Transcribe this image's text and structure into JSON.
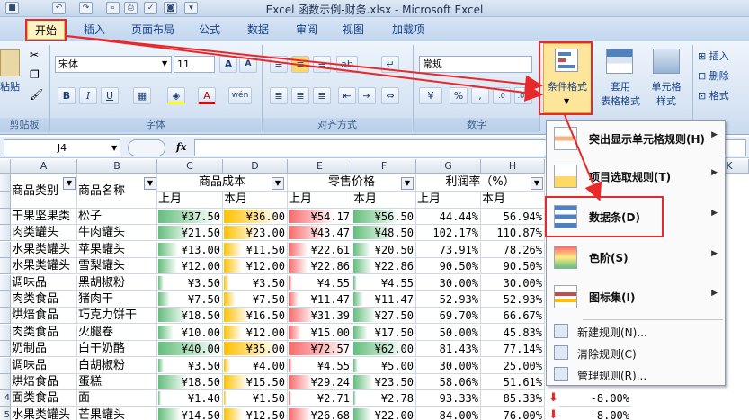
{
  "title": "Excel 函数示例-财务.xlsx - Microsoft Excel",
  "tabs": [
    "开始",
    "插入",
    "页面布局",
    "公式",
    "数据",
    "审阅",
    "视图",
    "加载项"
  ],
  "ribbon": {
    "font_name": "宋体",
    "font_size": "11",
    "number_format": "常规",
    "bold": "B",
    "italic": "I",
    "underline": "U",
    "grow": "A",
    "shrink": "A",
    "pct": "%",
    "comma": ",",
    "paste": "粘贴",
    "clipboard": "剪贴板",
    "font": "字体",
    "align": "对齐方式",
    "number": "数字",
    "cond_format": "条件格式",
    "table_format_1": "套用",
    "table_format_2": "表格格式",
    "cell_style_1": "单元格",
    "cell_style_2": "样式",
    "insert": "插入",
    "delete": "删除",
    "format": "格式"
  },
  "formula_bar": {
    "name_box": "J4",
    "fx": "fx"
  },
  "columns": [
    "A",
    "B",
    "C",
    "D",
    "E",
    "F",
    "G",
    "H",
    "K"
  ],
  "header": {
    "cat": "商品类别",
    "name": "商品名称",
    "cost": "商品成本",
    "price": "零售价格",
    "profit": "利润率（%）",
    "last": "上月",
    "this": "本月"
  },
  "row_numbers": [
    "",
    "",
    "",
    "",
    "",
    "",
    "",
    "",
    "",
    "",
    "",
    "",
    "",
    "",
    "",
    "",
    "4",
    "5"
  ],
  "rows": [
    {
      "cat": "干果坚果类",
      "name": "松子",
      "c1": "¥37.50",
      "c2": "¥36.00",
      "p1": "¥54.17",
      "p2": "¥56.50",
      "r1": "44.44%",
      "r2": "56.94%",
      "vc1": 37.5,
      "vc2": 36,
      "vp1": 54.17,
      "vp2": 56.5
    },
    {
      "cat": "肉类罐头",
      "name": "牛肉罐头",
      "c1": "¥21.50",
      "c2": "¥23.00",
      "p1": "¥43.47",
      "p2": "¥48.50",
      "r1": "102.17%",
      "r2": "110.87%",
      "vc1": 21.5,
      "vc2": 23,
      "vp1": 43.47,
      "vp2": 48.5
    },
    {
      "cat": "水果类罐头",
      "name": "苹果罐头",
      "c1": "¥13.00",
      "c2": "¥11.50",
      "p1": "¥22.61",
      "p2": "¥20.50",
      "r1": "73.91%",
      "r2": "78.26%",
      "vc1": 13,
      "vc2": 11.5,
      "vp1": 22.61,
      "vp2": 20.5
    },
    {
      "cat": "水果类罐头",
      "name": "雪梨罐头",
      "c1": "¥12.00",
      "c2": "¥12.00",
      "p1": "¥22.86",
      "p2": "¥22.86",
      "r1": "90.50%",
      "r2": "90.50%",
      "vc1": 12,
      "vc2": 12,
      "vp1": 22.86,
      "vp2": 22.86
    },
    {
      "cat": "调味品",
      "name": "黑胡椒粉",
      "c1": "¥3.50",
      "c2": "¥3.50",
      "p1": "¥4.55",
      "p2": "¥4.55",
      "r1": "30.00%",
      "r2": "30.00%",
      "vc1": 3.5,
      "vc2": 3.5,
      "vp1": 4.55,
      "vp2": 4.55
    },
    {
      "cat": "肉类食品",
      "name": "猪肉干",
      "c1": "¥7.50",
      "c2": "¥7.50",
      "p1": "¥11.47",
      "p2": "¥11.47",
      "r1": "52.93%",
      "r2": "52.93%",
      "vc1": 7.5,
      "vc2": 7.5,
      "vp1": 11.47,
      "vp2": 11.47
    },
    {
      "cat": "烘焙食品",
      "name": "巧克力饼干",
      "c1": "¥18.50",
      "c2": "¥16.50",
      "p1": "¥31.39",
      "p2": "¥27.50",
      "r1": "69.70%",
      "r2": "66.67%",
      "vc1": 18.5,
      "vc2": 16.5,
      "vp1": 31.39,
      "vp2": 27.5
    },
    {
      "cat": "肉类食品",
      "name": "火腿卷",
      "c1": "¥10.00",
      "c2": "¥12.00",
      "p1": "¥15.00",
      "p2": "¥17.50",
      "r1": "50.00%",
      "r2": "45.83%",
      "vc1": 10,
      "vc2": 12,
      "vp1": 15,
      "vp2": 17.5
    },
    {
      "cat": "奶制品",
      "name": "白干奶酪",
      "c1": "¥40.00",
      "c2": "¥35.00",
      "p1": "¥72.57",
      "p2": "¥62.00",
      "r1": "81.43%",
      "r2": "77.14%",
      "vc1": 40,
      "vc2": 35,
      "vp1": 72.57,
      "vp2": 62
    },
    {
      "cat": "调味品",
      "name": "白胡椒粉",
      "c1": "¥3.50",
      "c2": "¥4.00",
      "p1": "¥4.55",
      "p2": "¥5.00",
      "r1": "30.00%",
      "r2": "25.00%",
      "vc1": 3.5,
      "vc2": 4,
      "vp1": 4.55,
      "vp2": 5
    },
    {
      "cat": "烘焙食品",
      "name": "蛋糕",
      "c1": "¥18.50",
      "c2": "¥15.50",
      "p1": "¥29.24",
      "p2": "¥23.50",
      "r1": "58.06%",
      "r2": "51.61%",
      "vc1": 18.5,
      "vc2": 15.5,
      "vp1": 29.24,
      "vp2": 23.5
    },
    {
      "cat": "面类食品",
      "name": "面",
      "c1": "¥1.40",
      "c2": "¥1.50",
      "p1": "¥2.71",
      "p2": "¥2.78",
      "r1": "93.33%",
      "r2": "85.33%",
      "vc1": 1.4,
      "vc2": 1.5,
      "vp1": 2.71,
      "vp2": 2.78
    },
    {
      "cat": "水果类罐头",
      "name": "芒果罐头",
      "c1": "¥14.50",
      "c2": "¥12.50",
      "p1": "¥26.68",
      "p2": "¥22.00",
      "r1": "84.00%",
      "r2": "76.00%",
      "vc1": 14.5,
      "vc2": 12.5,
      "vp1": 26.68,
      "vp2": 22
    }
  ],
  "extra_col": [
    "-8.00%",
    "-8.00%"
  ],
  "menu": {
    "items": [
      {
        "label": "突出显示单元格规则(H)",
        "icon": "highlight-rules-icon"
      },
      {
        "label": "项目选取规则(T)",
        "icon": "top-bottom-rules-icon"
      },
      {
        "label": "数据条(D)",
        "icon": "data-bars-icon"
      },
      {
        "label": "色阶(S)",
        "icon": "color-scales-icon"
      },
      {
        "label": "图标集(I)",
        "icon": "icon-sets-icon"
      }
    ],
    "small": [
      {
        "label": "新建规则(N)...",
        "icon": "new-rule-icon"
      },
      {
        "label": "清除规则(C)",
        "icon": "clear-rules-icon"
      },
      {
        "label": "管理规则(R)...",
        "icon": "manage-rules-icon"
      }
    ]
  },
  "colors": {
    "accent_red": "#e8292b",
    "bar_green": "#63be7b",
    "bar_yellow": "#ffc000",
    "bar_red": "#f8696b"
  }
}
